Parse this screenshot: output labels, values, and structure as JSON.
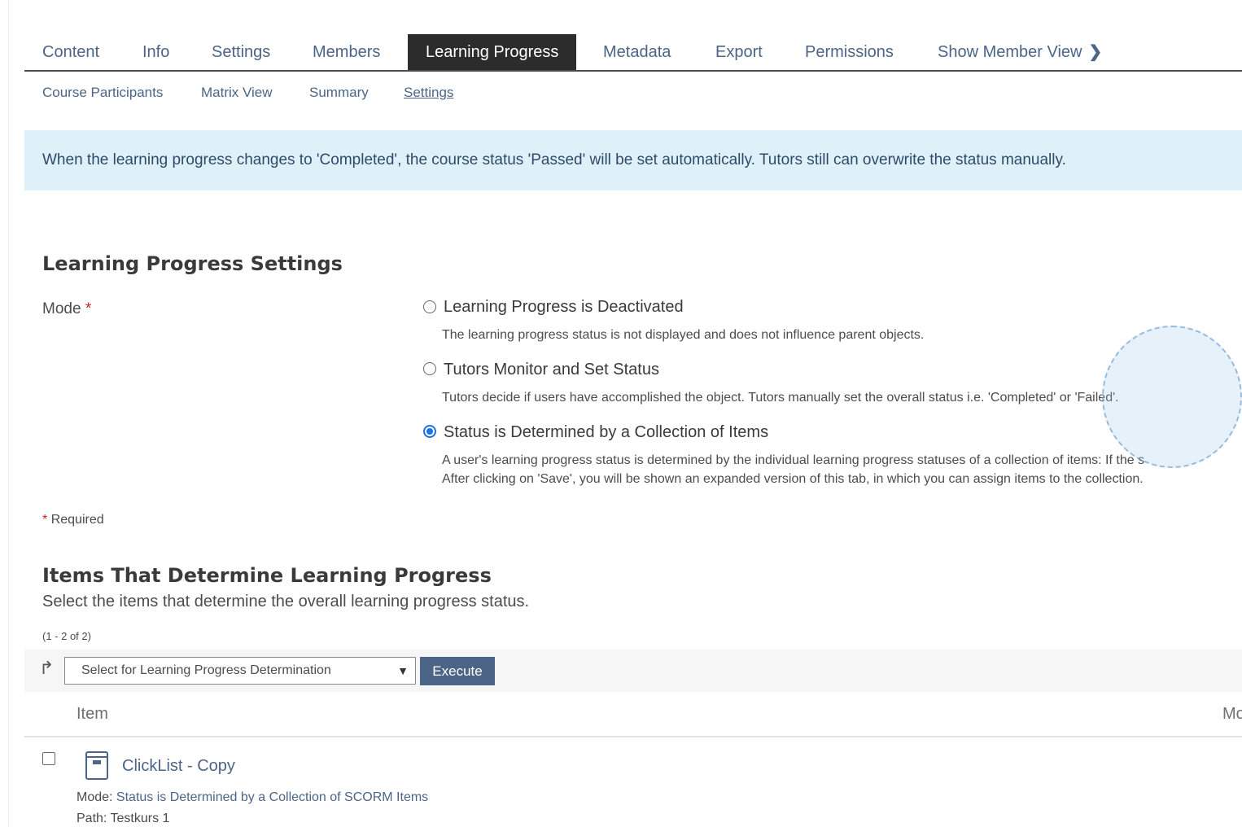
{
  "tabs": [
    {
      "label": "Content"
    },
    {
      "label": "Info"
    },
    {
      "label": "Settings"
    },
    {
      "label": "Members"
    },
    {
      "label": "Learning Progress"
    },
    {
      "label": "Metadata"
    },
    {
      "label": "Export"
    },
    {
      "label": "Permissions"
    },
    {
      "label": "Show Member View"
    }
  ],
  "active_tab": "Learning Progress",
  "subtabs": [
    {
      "label": "Course Participants"
    },
    {
      "label": "Matrix View"
    },
    {
      "label": "Summary"
    },
    {
      "label": "Settings"
    }
  ],
  "active_subtab": "Settings",
  "info_message": "When the learning progress changes to 'Completed', the course status 'Passed' will be set automatically. Tutors still can overwrite the status manually.",
  "settings": {
    "title": "Learning Progress Settings",
    "mode_label": "Mode",
    "required_marker": "*",
    "options": [
      {
        "label": "Learning Progress is Deactivated",
        "description": "The learning progress status is not displayed and does not influence parent objects.",
        "selected": false
      },
      {
        "label": "Tutors Monitor and Set Status",
        "description": "Tutors decide if users have accomplished the object. Tutors manually set the overall status i.e. 'Completed' or 'Failed'.",
        "selected": false
      },
      {
        "label": "Status is Determined by a Collection of Items",
        "description": "A user's learning progress status is determined by the individual learning progress statuses of a collection of items: If the s",
        "description2": "After clicking on 'Save', you will be shown an expanded version of this tab, in which you can assign items to the collection.",
        "selected": true
      }
    ],
    "required_note": "Required"
  },
  "items_section": {
    "title": "Items That Determine Learning Progress",
    "subtitle": "Select the items that determine the overall learning progress status.",
    "count": "(1 - 2 of 2)",
    "select_value": "Select for Learning Progress Determination",
    "execute_label": "Execute",
    "col_item": "Item",
    "col_mode": "Mo",
    "rows": [
      {
        "title": "ClickList - Copy",
        "mode_label": "Mode:",
        "mode_value": "Status is Determined by a Collection of SCORM Items",
        "path_label": "Path:",
        "path_value": "Testkurs 1"
      }
    ]
  },
  "colors": {
    "accent": "#4c6586",
    "active_tab_bg": "#2c2c2c",
    "info_bg": "#def0f8",
    "radio_checked": "#1a73e8"
  },
  "icons": {
    "tab_chevron": "chevron-right-icon",
    "bulk_action": "turn-right-arrow-icon",
    "select_caret": "chevron-down-icon",
    "item_type": "scorm-module-icon"
  }
}
